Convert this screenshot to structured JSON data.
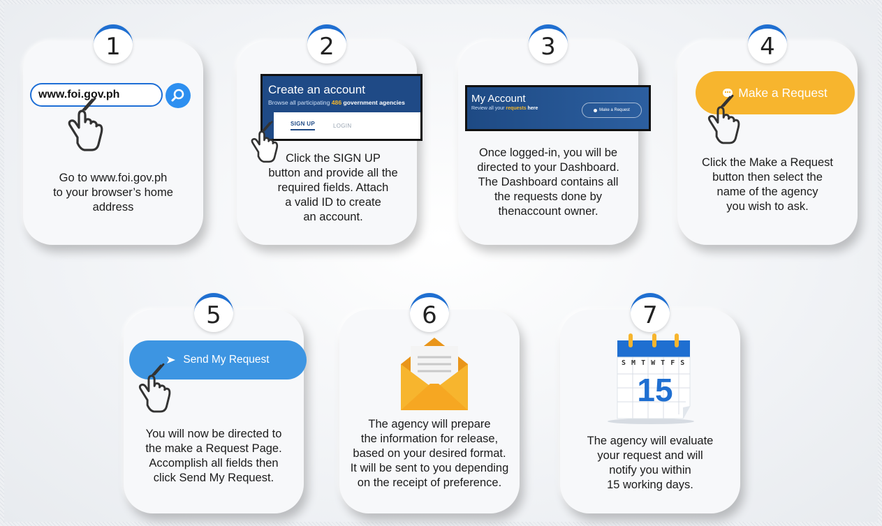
{
  "steps": [
    {
      "number": "1",
      "url": "www.foi.gov.ph",
      "description": "Go to www.foi.gov.ph\nto your browser’s home\naddress"
    },
    {
      "number": "2",
      "screen_title": "Create an account",
      "screen_sub_prefix": "Browse all participating ",
      "screen_sub_count": "486",
      "screen_sub_suffix": " government agencies",
      "tab_signup": "SIGN UP",
      "tab_login": "LOGIN",
      "description": "Click the SIGN UP\nbutton and provide all the\nrequired fields. Attach\na valid ID to create\nan account."
    },
    {
      "number": "3",
      "screen_title": "My Account",
      "screen_sub_prefix": "Review all your ",
      "screen_sub_highlight": "requests",
      "screen_sub_suffix": " here",
      "mini_button": "Make a Request",
      "description": "Once logged-in, you will be\ndirected to your Dashboard.\nThe Dashboard contains all\nthe requests done by\nthenaccount owner."
    },
    {
      "number": "4",
      "button_label": "Make a Request",
      "description": "Click the Make a Request\nbutton then select the\nname of the agency\nyou wish to ask."
    },
    {
      "number": "5",
      "button_label": "Send My Request",
      "description": "You will now be directed to\nthe make a Request Page.\nAccomplish all fields then\nclick Send My Request."
    },
    {
      "number": "6",
      "description": "The agency will prepare\nthe information for release,\nbased on your desired format.\nIt will be sent to you depending\non the receipt of preference."
    },
    {
      "number": "7",
      "calendar_days": "S M T W T F S",
      "calendar_date": "15",
      "description": "The agency will evaluate\nyour request and will\nnotify you within\n15 working days."
    }
  ],
  "colors": {
    "accent_blue": "#1f6fd1",
    "make_request_yellow": "#f7b52e",
    "send_request_blue": "#3d95e2",
    "account_navy": "#1f4a86",
    "envelope_orange": "#f2a11f"
  },
  "icons": [
    "pointing-hand-icon",
    "search-icon",
    "chat-icon",
    "send-arrow-icon",
    "envelope-icon",
    "calendar-icon"
  ]
}
